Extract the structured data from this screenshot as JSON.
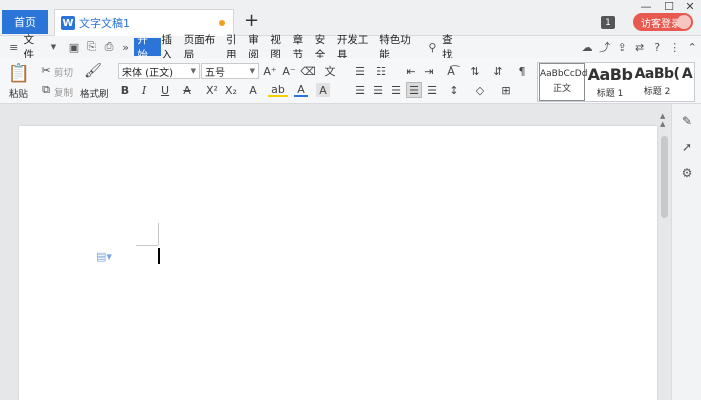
{
  "titlebar": {
    "home_tab": "首页",
    "doc_tab_title": "文字文稿1",
    "new_tab_icon": "plus-icon",
    "badge": "1",
    "login_label": "访客登录",
    "accent": "#2b74d8",
    "login_color": "#e85a4f"
  },
  "menu": {
    "file": "文件",
    "tabs": [
      "开始",
      "插入",
      "页面布局",
      "引用",
      "审阅",
      "视图",
      "章节",
      "安全",
      "开发工具",
      "特色功能"
    ],
    "active_tab": "开始",
    "search": "查找"
  },
  "ribbon": {
    "paste": "粘贴",
    "cut": "剪切",
    "copy": "复制",
    "format_painter": "格式刷",
    "font_name": "宋体 (正文)",
    "font_size": "五号",
    "styles": [
      {
        "sample": "AaBbCcDd",
        "name": "正文"
      },
      {
        "sample": "AaBb",
        "name": "标题 1"
      },
      {
        "sample": "AaBb(",
        "name": "标题 2"
      },
      {
        "sample": "A",
        "name": ""
      }
    ]
  }
}
